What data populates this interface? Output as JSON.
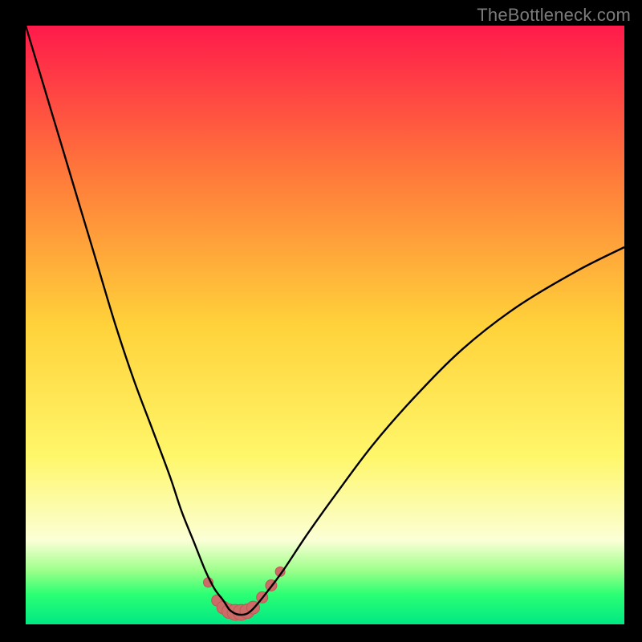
{
  "watermark": "TheBottleneck.com",
  "colors": {
    "frame": "#000000",
    "grad_top": "#ff1a4b",
    "grad_mid_upper": "#ff7a3a",
    "grad_mid": "#ffd23a",
    "grad_lower": "#fff76a",
    "grad_pale": "#fbffd6",
    "grad_green1": "#9dff8a",
    "grad_green2": "#2bff73",
    "grad_green3": "#00e884",
    "curve": "#000000",
    "marker_fill": "#cc6b68",
    "marker_stroke": "#bc5a57"
  },
  "chart_data": {
    "type": "line",
    "title": "",
    "xlabel": "",
    "ylabel": "",
    "xlim": [
      0,
      100
    ],
    "ylim": [
      0,
      100
    ],
    "series": [
      {
        "name": "bottleneck-curve",
        "x": [
          0,
          3,
          6,
          9,
          12,
          15,
          18,
          21,
          24,
          26,
          28,
          30,
          31.5,
          33,
          34,
          35,
          36,
          37,
          38,
          40,
          43,
          47,
          52,
          58,
          65,
          73,
          82,
          92,
          100
        ],
        "y": [
          100,
          90,
          80,
          70,
          60,
          50,
          41,
          33,
          25,
          19,
          14,
          9,
          6,
          4,
          2.5,
          1.8,
          1.6,
          1.8,
          2.6,
          5,
          9,
          15,
          22,
          30,
          38,
          46,
          53,
          59,
          63
        ]
      }
    ],
    "markers": {
      "name": "highlight-band",
      "x": [
        30.5,
        32.0,
        33.0,
        34.0,
        35.0,
        36.0,
        37.0,
        38.0,
        39.5,
        41.0,
        42.5
      ],
      "y": [
        7.0,
        4.0,
        2.8,
        2.2,
        2.0,
        2.0,
        2.2,
        2.8,
        4.5,
        6.5,
        8.8
      ],
      "r": [
        6,
        7,
        8,
        9,
        10,
        10,
        9,
        8,
        7,
        7,
        6
      ]
    }
  }
}
